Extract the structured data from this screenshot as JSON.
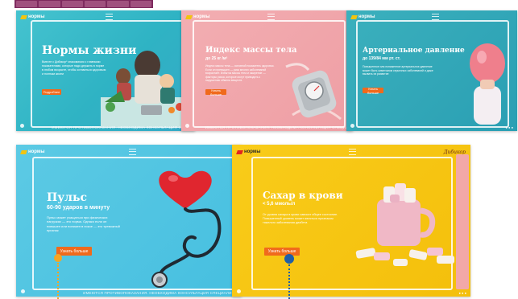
{
  "browser_tabs": [
    "",
    "",
    "",
    "",
    "",
    ""
  ],
  "brand": {
    "logo_text": "нормы",
    "partner_logo": "Дибикор"
  },
  "footer_disclaimer": "ИМЕЮТСЯ ПРОТИВОПОКАЗАНИЯ. НЕОБХОДИМА КОНСУЛЬТАЦИЯ СПЕЦИАЛИСТА",
  "slides": [
    {
      "title": "Нормы жизни",
      "subtitle": "",
      "body": "Вместе с Дибикор* знакомимся с главными показателями, которые надо держать в норме в любом возрасте, чтобы оставаться здоровым и полным жизни",
      "button": "Подробнее"
    },
    {
      "title": "Индекс массы тела",
      "subtitle": "до 25 кг /м²",
      "body": "Индекс массы тела — основной показатель здоровья. Если он превышен — риск многих заболеваний возрастает. Избыток массы тела и ожирение — факторы риска, которые могут приводить к нарушению обмена веществ.",
      "button": "Узнать больше"
    },
    {
      "title": "Артериальное давление",
      "subtitle": "до 139/84 мм рт. ст.",
      "body": "Повышенное или пониженное артериальное давление может быть симптомом серьезных заболеваний и даже вызвать их развитие",
      "button": "Узнать больше"
    },
    {
      "title": "Пульс",
      "subtitle": "60-90 ударов в минуту",
      "body": "Пульс может учащаться при физических нагрузках — это норма. Однако если он повышен или понижен в покое — это тревожный признак",
      "button": "Узнать больше"
    },
    {
      "title": "Сахар в крови",
      "subtitle": "< 5,6 ммоль/л",
      "body": "От уровня сахара в крови зависит общее состояние. Повышенный уровень может являться признаком тяжелого заболевания диабета",
      "button": "Узнать больше"
    }
  ],
  "colors": {
    "teal": "#2fb3c4",
    "pink": "#f0a3a8",
    "teal_dark": "#2a9fb3",
    "cyan": "#55c8e2",
    "yellow": "#f7c614",
    "accent_orange": "#f06a1c",
    "annotation_orange": "#f5a623",
    "annotation_blue": "#1f5fa8"
  },
  "icons": [
    "menu-icon",
    "heart-icon",
    "stethoscope-icon",
    "scale-icon",
    "balloon-icon",
    "marshmallow-cup-icon"
  ]
}
